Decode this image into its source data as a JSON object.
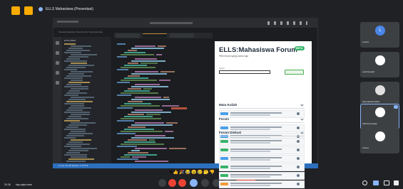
{
  "top_bar": {
    "title": "ELLS Mahasiswa (Presentasi)"
  },
  "editor": {
    "menu": "File  Edit  Selection  View  Go  Run  Terminal  Help",
    "explorer_title": "EXPLORER",
    "status": "Ln 42, Col 18  Spaces: 4  UTF-8"
  },
  "forum": {
    "title": "ELLS:Mahasiswa Forum",
    "beta": "BETA",
    "subtitle": "Pilih forum yang kamu tuju",
    "search_label": "Search",
    "sections": [
      {
        "title": "Mata Kuliah",
        "posts": 1
      },
      {
        "title": "Forum",
        "posts": 2
      },
      {
        "title": "Forum Diskusi",
        "posts": 6
      }
    ],
    "badge_colors": [
      "#4a9ee8",
      "#4a9ee8",
      "#4a9ee8",
      "#38b36a",
      "#38b36a",
      "#4a9ee8",
      "#38b36a",
      "#38b36a",
      "#f29a38"
    ]
  },
  "participants": [
    {
      "name": "Lecturer",
      "avatar_color": "#4a86e8",
      "initial": "L"
    },
    {
      "name": "Louis Reynardi",
      "avatar_color": "#ffffff"
    },
    {
      "name": "Tifiya Wandira Selfani",
      "avatar_color": "#e0e0e0"
    },
    {
      "name": "Adhimas Ag Tegas",
      "avatar_color": "#ffffff",
      "highlighted": true
    },
    {
      "name": "Lainnya",
      "avatar_color": "#ffffff"
    }
  ],
  "reactions": [
    "♥",
    "👍",
    "🎉",
    "😂",
    "😮",
    "😢",
    "🤔",
    "👎"
  ],
  "bottom_bar": {
    "time": "20.26",
    "meeting": "nbp-vqbc-mwe"
  }
}
